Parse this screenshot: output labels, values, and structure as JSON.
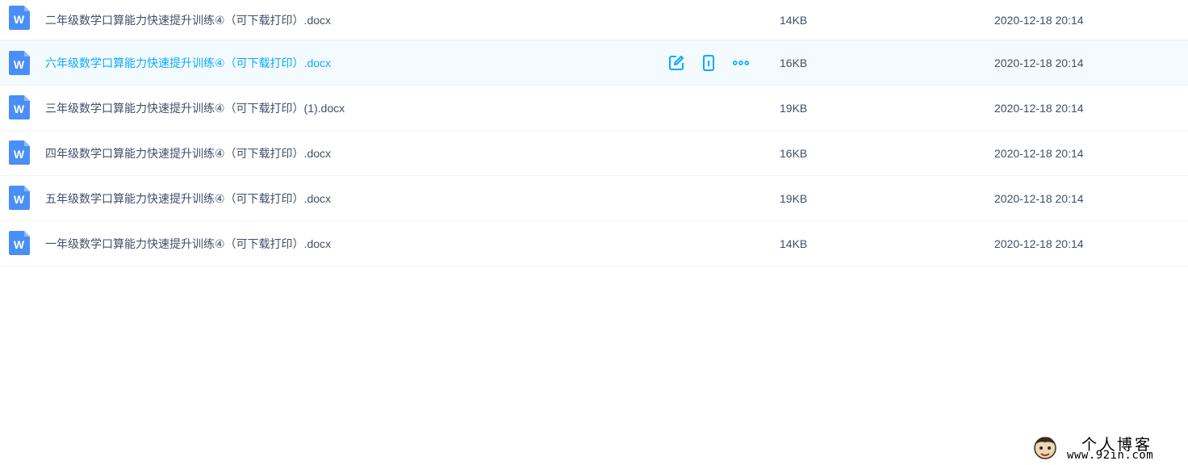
{
  "files": [
    {
      "name": "二年级数学口算能力快速提升训练④（可下载打印）.docx",
      "size": "14KB",
      "date": "2020-12-18 20:14",
      "hovered": false
    },
    {
      "name": "六年级数学口算能力快速提升训练④（可下载打印）.docx",
      "size": "16KB",
      "date": "2020-12-18 20:14",
      "hovered": true
    },
    {
      "name": "三年级数学口算能力快速提升训练④（可下载打印）(1).docx",
      "size": "19KB",
      "date": "2020-12-18 20:14",
      "hovered": false
    },
    {
      "name": "四年级数学口算能力快速提升训练④（可下载打印）.docx",
      "size": "16KB",
      "date": "2020-12-18 20:14",
      "hovered": false
    },
    {
      "name": "五年级数学口算能力快速提升训练④（可下载打印）.docx",
      "size": "19KB",
      "date": "2020-12-18 20:14",
      "hovered": false
    },
    {
      "name": "一年级数学口算能力快速提升训练④（可下载打印）.docx",
      "size": "14KB",
      "date": "2020-12-18 20:14",
      "hovered": false
    }
  ],
  "row_actions": {
    "icons": [
      "edit-icon",
      "phone-icon",
      "more-icon"
    ]
  },
  "watermark": {
    "title": "个人博客",
    "url": "www.92in.com"
  },
  "colors": {
    "accent": "#09aaff",
    "text": "#424e67",
    "word_blue": "#4a8ef7",
    "hover_bg": "#f4fbff"
  }
}
